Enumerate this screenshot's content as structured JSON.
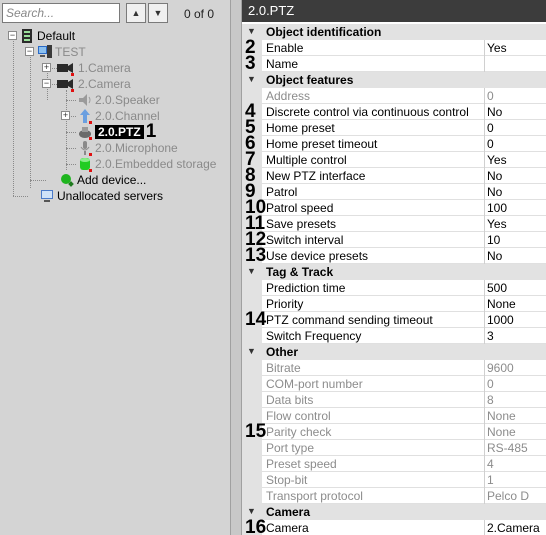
{
  "search": {
    "placeholder": "Search...",
    "value": ""
  },
  "nav": {
    "up_icon": "chevron-up-icon",
    "down_icon": "chevron-down-icon",
    "counter": "0 of 0"
  },
  "tree": {
    "nodes": [
      {
        "label": "Default",
        "icon": "server-rack-icon",
        "state": "normal"
      },
      {
        "label": "TEST",
        "icon": "computer-icon",
        "state": "dim"
      },
      {
        "label": "1.Camera",
        "icon": "camera-icon",
        "state": "dim"
      },
      {
        "label": "2.Camera",
        "icon": "camera-icon",
        "state": "dim"
      },
      {
        "label": "2.0.Speaker",
        "icon": "speaker-icon",
        "state": "dim"
      },
      {
        "label": "2.0.Channel",
        "icon": "channel-icon",
        "state": "dim"
      },
      {
        "label": "2.0.PTZ",
        "icon": "ptz-icon",
        "state": "selected"
      },
      {
        "label": "2.0.Microphone",
        "icon": "microphone-icon",
        "state": "dim"
      },
      {
        "label": "2.0.Embedded storage",
        "icon": "storage-icon",
        "state": "dim"
      },
      {
        "label": "Add device...",
        "icon": "add-device-icon",
        "state": "normal"
      },
      {
        "label": "Unallocated servers",
        "icon": "monitor-icon",
        "state": "normal"
      }
    ],
    "marker": "1"
  },
  "panel": {
    "title": "2.0.PTZ",
    "categories": [
      {
        "name": "Object identification",
        "rows": [
          {
            "n": "Enable",
            "v": "Yes",
            "ro": false,
            "m": "2"
          },
          {
            "n": "Name",
            "v": "",
            "ro": false,
            "m": "3"
          }
        ]
      },
      {
        "name": "Object features",
        "rows": [
          {
            "n": "Address",
            "v": "0",
            "ro": true,
            "m": ""
          },
          {
            "n": "Discrete control via continuous control",
            "v": "No",
            "ro": false,
            "m": "4"
          },
          {
            "n": "Home preset",
            "v": "0",
            "ro": false,
            "m": "5"
          },
          {
            "n": "Home preset timeout",
            "v": "0",
            "ro": false,
            "m": "6"
          },
          {
            "n": "Multiple control",
            "v": "Yes",
            "ro": false,
            "m": "7"
          },
          {
            "n": "New PTZ interface",
            "v": "No",
            "ro": false,
            "m": "8"
          },
          {
            "n": "Patrol",
            "v": "No",
            "ro": false,
            "m": "9"
          },
          {
            "n": "Patrol speed",
            "v": "100",
            "ro": false,
            "m": "10"
          },
          {
            "n": "Save presets",
            "v": "Yes",
            "ro": false,
            "m": "11"
          },
          {
            "n": "Switch interval",
            "v": "10",
            "ro": false,
            "m": "12"
          },
          {
            "n": "Use device presets",
            "v": "No",
            "ro": false,
            "m": "13"
          }
        ]
      },
      {
        "name": "Tag & Track",
        "rows": [
          {
            "n": "Prediction time",
            "v": "500",
            "ro": false,
            "m": ""
          },
          {
            "n": "Priority",
            "v": "None",
            "ro": false,
            "m": ""
          },
          {
            "n": "PTZ command sending timeout",
            "v": "1000",
            "ro": false,
            "m": "14"
          },
          {
            "n": "Switch Frequency",
            "v": "3",
            "ro": false,
            "m": ""
          }
        ]
      },
      {
        "name": "Other",
        "rows": [
          {
            "n": "Bitrate",
            "v": "9600",
            "ro": true,
            "m": ""
          },
          {
            "n": "COM-port number",
            "v": "0",
            "ro": true,
            "m": ""
          },
          {
            "n": "Data bits",
            "v": "8",
            "ro": true,
            "m": ""
          },
          {
            "n": "Flow control",
            "v": "None",
            "ro": true,
            "m": ""
          },
          {
            "n": "Parity check",
            "v": "None",
            "ro": true,
            "m": "15"
          },
          {
            "n": "Port type",
            "v": "RS-485",
            "ro": true,
            "m": ""
          },
          {
            "n": "Preset speed",
            "v": "4",
            "ro": true,
            "m": ""
          },
          {
            "n": "Stop-bit",
            "v": "1",
            "ro": true,
            "m": ""
          },
          {
            "n": "Transport protocol",
            "v": "Pelco D",
            "ro": true,
            "m": ""
          }
        ]
      },
      {
        "name": "Camera",
        "rows": [
          {
            "n": "Camera",
            "v": "2.Camera",
            "ro": false,
            "m": "16"
          }
        ]
      }
    ]
  },
  "colors": {
    "title_bg": "#3c3c3c",
    "category_bg": "#e2e2e2",
    "selection_bg": "#000000",
    "readonly_text": "#8c8c8c",
    "marker_red": "#e01010"
  }
}
